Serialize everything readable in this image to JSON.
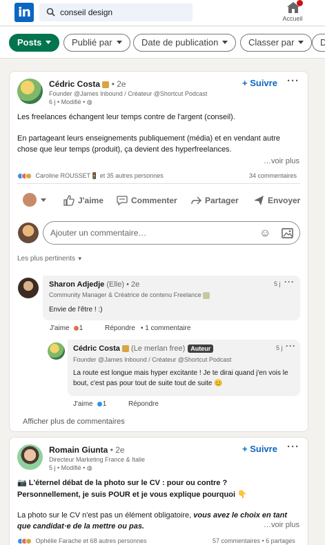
{
  "nav": {
    "logo_text": "in",
    "search_value": "conseil design",
    "home_label": "Accueil"
  },
  "filters": {
    "items": [
      {
        "label": "Posts",
        "active": true
      },
      {
        "label": "Publié par"
      },
      {
        "label": "Date de publication"
      },
      {
        "label": "Classer par"
      },
      {
        "label": "D"
      }
    ]
  },
  "post1": {
    "author": "Cédric Costa",
    "degree": "• 2e",
    "headline": "Founder @James Inbound / Créateur @Shortcut Podcast",
    "time": "6 j • Modifié •",
    "follow": "+ Suivre",
    "paragraph1": "Les freelances échangent leur temps contre de l'argent (conseil).",
    "paragraph2": "En partageant leurs enseignements publiquement (média) et en vendant autre chose que leur temps (produit), ça devient des hyperfreelances.",
    "see_more": "…voir plus",
    "reactions": "Caroline ROUSSET🚦 et 35 autres personnes",
    "comments_count": "34 commentaires",
    "actions": {
      "like": "J'aime",
      "comment": "Commenter",
      "share": "Partager",
      "send": "Envoyer"
    },
    "comment_placeholder": "Ajouter un commentaire…",
    "sort_label": "Les plus pertinents",
    "comments": [
      {
        "author": "Sharon Adjedje",
        "pronoun": "(Elle)",
        "degree": "• 2e",
        "headline": "Community Manager & Créatrice de contenu Freelance",
        "time": "5 j",
        "text": "Envie de l'être ! :)",
        "like": "J'aime",
        "like_count": "1",
        "reply": "Répondre",
        "reply_count": "• 1 commentaire"
      }
    ],
    "reply": {
      "author": "Cédric Costa",
      "nickname": "(Le merlan free)",
      "badge": "Auteur",
      "headline": "Founder @James Inbound / Créateur @Shortcut Podcast",
      "time": "5 j",
      "text": "La route est longue mais hyper excitante ! Je te dirai quand j'en vois le bout, c'est pas pour tout de suite tout de suite 😊",
      "like": "J'aime",
      "like_count": "1",
      "reply": "Répondre"
    },
    "more_comments": "Afficher plus de commentaires"
  },
  "post2": {
    "author": "Romain Giunta",
    "degree": "• 2e",
    "headline": "Directeur Marketing France & Italie",
    "time": "5 j • Modifié •",
    "follow": "+ Suivre",
    "line1": "📷 L'éternel débat de la photo sur le CV : pour ou contre ?",
    "line2": "Personnellement, je suis POUR et je vous explique pourquoi 👇",
    "line3a": "La photo sur le CV n'est pas un élément obligatoire, ",
    "line3b": "vous avez le choix en tant",
    "line4": "que candidat·e de la mettre ou pas.",
    "see_more": "…voir plus",
    "reactions": "Ophélie Farache et 68 autres personnes",
    "comments_shares": "57 commentaires • 6 partages"
  },
  "colors": {
    "brand": "#0a66c2",
    "filter_active": "#01754f",
    "background": "#f4f2ee"
  }
}
